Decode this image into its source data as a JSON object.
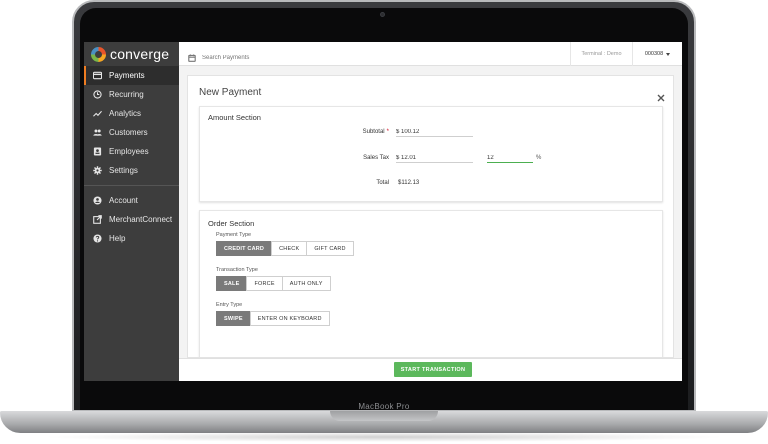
{
  "device": {
    "label": "MacBook Pro"
  },
  "app": {
    "name": "converge"
  },
  "sidebar": {
    "items": [
      {
        "label": "Payments",
        "icon": "card-icon",
        "active": true
      },
      {
        "label": "Recurring",
        "icon": "clock-icon"
      },
      {
        "label": "Analytics",
        "icon": "trend-icon"
      },
      {
        "label": "Customers",
        "icon": "people-icon"
      },
      {
        "label": "Employees",
        "icon": "badge-icon"
      },
      {
        "label": "Settings",
        "icon": "gear-icon"
      }
    ],
    "secondary": [
      {
        "label": "Account",
        "icon": "account-icon"
      },
      {
        "label": "MerchantConnect",
        "icon": "external-link-icon"
      },
      {
        "label": "Help",
        "icon": "help-icon"
      }
    ]
  },
  "topbar": {
    "search_placeholder": "Search Payments",
    "terminal": "Terminal : Demo",
    "account": "000308"
  },
  "panel": {
    "title": "New Payment",
    "amount": {
      "title": "Amount Section",
      "subtotal_label": "Subtotal",
      "subtotal_value": "$ 100.12",
      "tax_label": "Sales Tax",
      "tax_value": "$ 12.01",
      "tax_percent": "12",
      "percent_unit": "%",
      "total_label": "Total",
      "total_value": "$112.13"
    },
    "order": {
      "title": "Order Section",
      "payment_type_label": "Payment Type",
      "payment_types": [
        "CREDIT CARD",
        "CHECK",
        "GIFT CARD"
      ],
      "transaction_type_label": "Transaction Type",
      "transaction_types": [
        "SALE",
        "FORCE",
        "AUTH ONLY"
      ],
      "entry_type_label": "Entry Type",
      "entry_types": [
        "SWIPE",
        "ENTER ON KEYBOARD"
      ]
    }
  },
  "footer": {
    "start_label": "START TRANSACTION"
  },
  "colors": {
    "accent": "#ef7d22",
    "primary_button": "#5cb85c",
    "sidebar_bg": "#3d3d3d",
    "selected_segment": "#7a7a7a",
    "required": "#d0021b"
  }
}
